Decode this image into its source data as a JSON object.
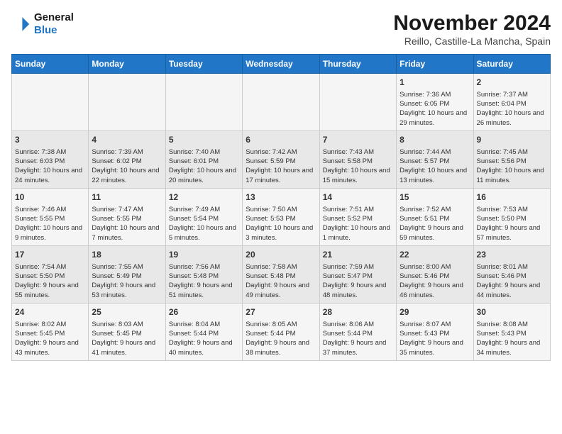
{
  "logo": {
    "line1": "General",
    "line2": "Blue"
  },
  "title": "November 2024",
  "subtitle": "Reillo, Castille-La Mancha, Spain",
  "headers": [
    "Sunday",
    "Monday",
    "Tuesday",
    "Wednesday",
    "Thursday",
    "Friday",
    "Saturday"
  ],
  "weeks": [
    [
      {
        "day": "",
        "info": ""
      },
      {
        "day": "",
        "info": ""
      },
      {
        "day": "",
        "info": ""
      },
      {
        "day": "",
        "info": ""
      },
      {
        "day": "",
        "info": ""
      },
      {
        "day": "1",
        "info": "Sunrise: 7:36 AM\nSunset: 6:05 PM\nDaylight: 10 hours and 29 minutes."
      },
      {
        "day": "2",
        "info": "Sunrise: 7:37 AM\nSunset: 6:04 PM\nDaylight: 10 hours and 26 minutes."
      }
    ],
    [
      {
        "day": "3",
        "info": "Sunrise: 7:38 AM\nSunset: 6:03 PM\nDaylight: 10 hours and 24 minutes."
      },
      {
        "day": "4",
        "info": "Sunrise: 7:39 AM\nSunset: 6:02 PM\nDaylight: 10 hours and 22 minutes."
      },
      {
        "day": "5",
        "info": "Sunrise: 7:40 AM\nSunset: 6:01 PM\nDaylight: 10 hours and 20 minutes."
      },
      {
        "day": "6",
        "info": "Sunrise: 7:42 AM\nSunset: 5:59 PM\nDaylight: 10 hours and 17 minutes."
      },
      {
        "day": "7",
        "info": "Sunrise: 7:43 AM\nSunset: 5:58 PM\nDaylight: 10 hours and 15 minutes."
      },
      {
        "day": "8",
        "info": "Sunrise: 7:44 AM\nSunset: 5:57 PM\nDaylight: 10 hours and 13 minutes."
      },
      {
        "day": "9",
        "info": "Sunrise: 7:45 AM\nSunset: 5:56 PM\nDaylight: 10 hours and 11 minutes."
      }
    ],
    [
      {
        "day": "10",
        "info": "Sunrise: 7:46 AM\nSunset: 5:55 PM\nDaylight: 10 hours and 9 minutes."
      },
      {
        "day": "11",
        "info": "Sunrise: 7:47 AM\nSunset: 5:55 PM\nDaylight: 10 hours and 7 minutes."
      },
      {
        "day": "12",
        "info": "Sunrise: 7:49 AM\nSunset: 5:54 PM\nDaylight: 10 hours and 5 minutes."
      },
      {
        "day": "13",
        "info": "Sunrise: 7:50 AM\nSunset: 5:53 PM\nDaylight: 10 hours and 3 minutes."
      },
      {
        "day": "14",
        "info": "Sunrise: 7:51 AM\nSunset: 5:52 PM\nDaylight: 10 hours and 1 minute."
      },
      {
        "day": "15",
        "info": "Sunrise: 7:52 AM\nSunset: 5:51 PM\nDaylight: 9 hours and 59 minutes."
      },
      {
        "day": "16",
        "info": "Sunrise: 7:53 AM\nSunset: 5:50 PM\nDaylight: 9 hours and 57 minutes."
      }
    ],
    [
      {
        "day": "17",
        "info": "Sunrise: 7:54 AM\nSunset: 5:50 PM\nDaylight: 9 hours and 55 minutes."
      },
      {
        "day": "18",
        "info": "Sunrise: 7:55 AM\nSunset: 5:49 PM\nDaylight: 9 hours and 53 minutes."
      },
      {
        "day": "19",
        "info": "Sunrise: 7:56 AM\nSunset: 5:48 PM\nDaylight: 9 hours and 51 minutes."
      },
      {
        "day": "20",
        "info": "Sunrise: 7:58 AM\nSunset: 5:48 PM\nDaylight: 9 hours and 49 minutes."
      },
      {
        "day": "21",
        "info": "Sunrise: 7:59 AM\nSunset: 5:47 PM\nDaylight: 9 hours and 48 minutes."
      },
      {
        "day": "22",
        "info": "Sunrise: 8:00 AM\nSunset: 5:46 PM\nDaylight: 9 hours and 46 minutes."
      },
      {
        "day": "23",
        "info": "Sunrise: 8:01 AM\nSunset: 5:46 PM\nDaylight: 9 hours and 44 minutes."
      }
    ],
    [
      {
        "day": "24",
        "info": "Sunrise: 8:02 AM\nSunset: 5:45 PM\nDaylight: 9 hours and 43 minutes."
      },
      {
        "day": "25",
        "info": "Sunrise: 8:03 AM\nSunset: 5:45 PM\nDaylight: 9 hours and 41 minutes."
      },
      {
        "day": "26",
        "info": "Sunrise: 8:04 AM\nSunset: 5:44 PM\nDaylight: 9 hours and 40 minutes."
      },
      {
        "day": "27",
        "info": "Sunrise: 8:05 AM\nSunset: 5:44 PM\nDaylight: 9 hours and 38 minutes."
      },
      {
        "day": "28",
        "info": "Sunrise: 8:06 AM\nSunset: 5:44 PM\nDaylight: 9 hours and 37 minutes."
      },
      {
        "day": "29",
        "info": "Sunrise: 8:07 AM\nSunset: 5:43 PM\nDaylight: 9 hours and 35 minutes."
      },
      {
        "day": "30",
        "info": "Sunrise: 8:08 AM\nSunset: 5:43 PM\nDaylight: 9 hours and 34 minutes."
      }
    ]
  ]
}
